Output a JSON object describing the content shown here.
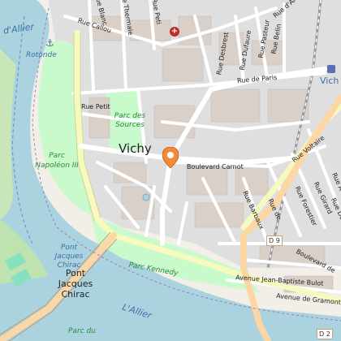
{
  "map": {
    "cities": {
      "main": "Vichy",
      "station_partial": "Vich"
    },
    "water": {
      "river_top": "d'Allier",
      "river_bottom": "L'Allier",
      "port": "Rotonde"
    },
    "parks": {
      "sources": "Parc des Sources",
      "napoleon": "Parc Napoléon III",
      "kennedy": "Parc Kennedy",
      "bottom_partial": "Parc du"
    },
    "bridges": {
      "blue_label": "Pont Jacques Chirac",
      "main_label": "Pont Jacques Chirac"
    },
    "streets": {
      "callou": "Rue Callou",
      "petit": "Rue Petit",
      "desbrest": "Rue Desbrest",
      "dufaure": "Rue Dufaure",
      "paris": "Rue de Paris",
      "boulevard_carnot": "Boulevard Carnot",
      "voltaire": "Rue Voltaire",
      "barbaux": "Rue Barbaux",
      "blanc": "Rue Blanc",
      "thermale": "Rue Thermale",
      "bulot": "Avenue Jean-Baptiste Bulot",
      "gramont": "Avenue de Gramont",
      "forestier": "Rue Forestier",
      "girard": "Rue Girard",
      "boulevard_denier": "Boulevard de",
      "pasteur": "Rue Pasteur",
      "belin": "Rue Belin",
      "rue_a": "Rue A",
      "rue_de": "Rue de",
      "petiot": "Rue Peti",
      "durand": "Rue Durand",
      "arcachon": "Rue d'Ar"
    },
    "road_shields": [
      "D 9",
      "D 2"
    ],
    "icons": {
      "hospital": "hospital-cross-icon",
      "marker": "tourist-attraction-marker-icon",
      "anchor": "port-anchor-icon",
      "station": "railway-station-icon"
    }
  }
}
